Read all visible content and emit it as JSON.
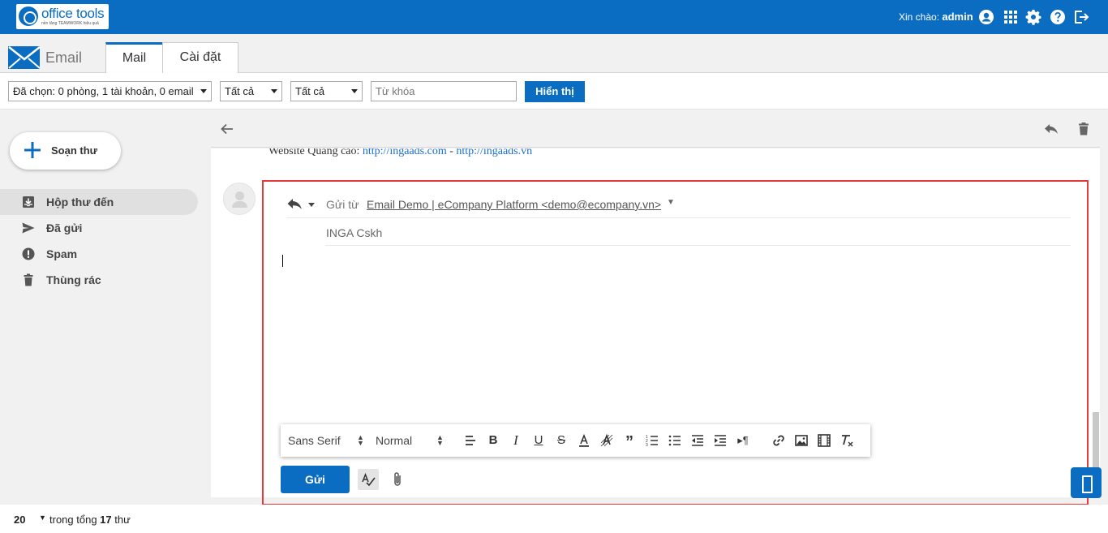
{
  "header": {
    "logo_text": "office tools",
    "logo_subtext": "nền tảng TEAMWORK hiệu quả",
    "greeting_label": "Xin chào:",
    "username": "admin",
    "icons": [
      "user-circle-icon",
      "apps-grid-icon",
      "gear-icon",
      "help-icon",
      "logout-icon"
    ]
  },
  "appbar": {
    "title": "Email",
    "tabs": [
      {
        "label": "Mail",
        "active": true
      },
      {
        "label": "Cài đặt",
        "active": false
      }
    ]
  },
  "filters": {
    "selection": "Đã chọn: 0 phòng, 1 tài khoản, 0 email",
    "filter1": "Tất cả",
    "filter2": "Tất cả",
    "keyword_placeholder": "Từ khóa",
    "show_button": "Hiển thị"
  },
  "sidebar": {
    "compose_label": "Soạn thư",
    "items": [
      {
        "label": "Hộp thư đến",
        "icon": "inbox-icon",
        "active": true
      },
      {
        "label": "Đã gửi",
        "icon": "send-icon",
        "active": false
      },
      {
        "label": "Spam",
        "icon": "spam-icon",
        "active": false
      },
      {
        "label": "Thùng rác",
        "icon": "trash-icon",
        "active": false
      }
    ]
  },
  "message": {
    "previous_text_prefix": "Website Quảng cáo:",
    "previous_link1": "http://ingaads.com",
    "previous_sep": "-",
    "previous_link2": "http://ingaads.vn"
  },
  "reply": {
    "from_label": "Gửi từ",
    "from_value": "Email Demo | eCompany Platform <demo@ecompany.vn>",
    "to_value": "INGA Cskh",
    "font_family": "Sans Serif",
    "font_size": "Normal",
    "send_label": "Gửi"
  },
  "footer": {
    "page_size": "20",
    "total_prefix": "trong tổng",
    "total_count": "17",
    "total_suffix": "thư"
  },
  "colors": {
    "brand": "#0a6dc2",
    "highlight": "#e5393a"
  }
}
